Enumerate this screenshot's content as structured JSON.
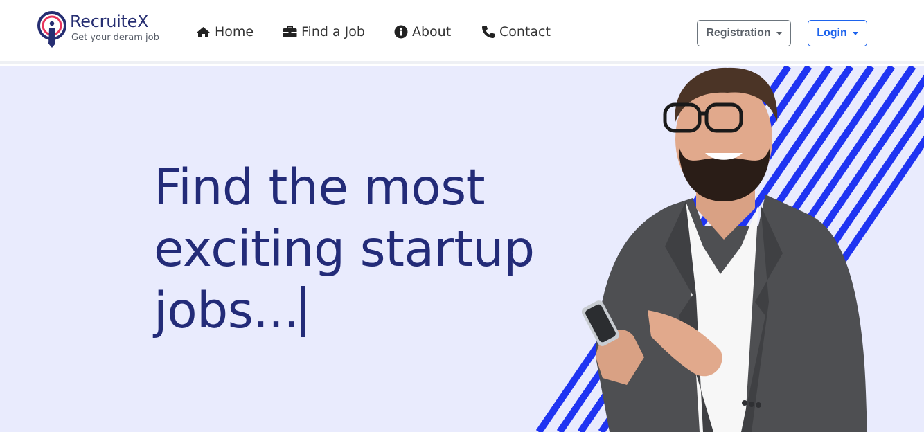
{
  "brand": {
    "name": "RecruiteX",
    "tagline": "Get your deram job",
    "logo_icon": "pin-person-icon"
  },
  "nav": {
    "items": [
      {
        "label": "Home",
        "icon": "home-icon"
      },
      {
        "label": "Find a Job",
        "icon": "briefcase-icon"
      },
      {
        "label": "About",
        "icon": "info-icon"
      },
      {
        "label": "Contact",
        "icon": "phone-icon"
      }
    ],
    "registration_label": "Registration",
    "login_label": "Login"
  },
  "hero": {
    "title_line1": "Find the most",
    "title_line2": "exciting startup",
    "title_line3": "jobs...",
    "background_color": "#e9ebfd",
    "title_color": "#232b78",
    "stripe_color": "#1f34f2"
  },
  "colors": {
    "brand": "#262e72",
    "accent": "#1d63ed",
    "logo_ring": "#e8345c"
  }
}
